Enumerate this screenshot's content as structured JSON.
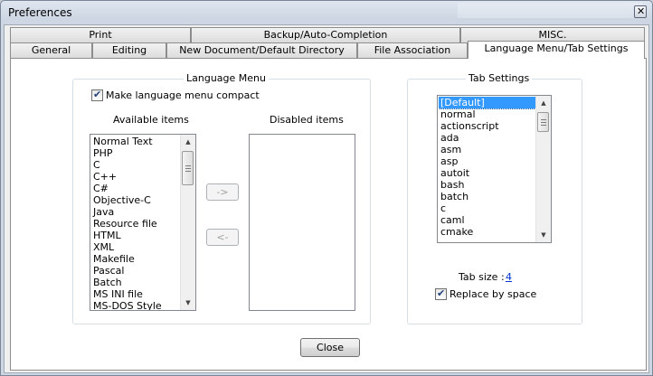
{
  "window": {
    "title": "Preferences",
    "close_glyph": "✕"
  },
  "tabs_row1": [
    {
      "label": "Print"
    },
    {
      "label": "Backup/Auto-Completion"
    },
    {
      "label": "MISC."
    }
  ],
  "tabs_row2": [
    {
      "label": "General"
    },
    {
      "label": "Editing"
    },
    {
      "label": "New Document/Default Directory"
    },
    {
      "label": "File Association"
    },
    {
      "label": "Language Menu/Tab Settings",
      "active": true
    }
  ],
  "language_menu": {
    "group_title": "Language Menu",
    "compact_label": "Make language menu compact",
    "compact_checked": true,
    "available_header": "Available items",
    "disabled_header": "Disabled items",
    "available_items": [
      "Normal Text",
      "PHP",
      "C",
      "C++",
      "C#",
      "Objective-C",
      "Java",
      "Resource file",
      "HTML",
      "XML",
      "Makefile",
      "Pascal",
      "Batch",
      "MS INI file",
      "MS-DOS Style"
    ],
    "disabled_items": [],
    "move_right_label": "->",
    "move_left_label": "<-"
  },
  "tab_settings": {
    "group_title": "Tab Settings",
    "items": [
      "[Default]",
      "normal",
      "actionscript",
      "ada",
      "asm",
      "asp",
      "autoit",
      "bash",
      "batch",
      "c",
      "caml",
      "cmake"
    ],
    "selected_index": 0,
    "tab_size_label": "Tab size :",
    "tab_size_value": "4",
    "replace_label": "Replace by space",
    "replace_checked": true
  },
  "footer": {
    "close_label": "Close"
  },
  "icons": {
    "check": "✔",
    "scroll_up": "▲",
    "scroll_down": "▼"
  }
}
